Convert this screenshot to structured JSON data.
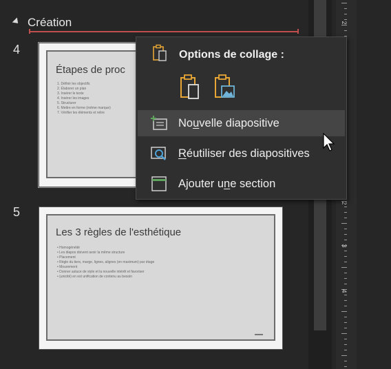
{
  "section": {
    "name": "Création"
  },
  "slides": [
    {
      "number": "4",
      "title": "Étapes de proc",
      "bullets": [
        "1.  Définir les objectifs",
        "2.  Élaborer un plan",
        "3.  Insérer le texte",
        "4.  Insérer les images",
        "5.  Structurer",
        "6.  Mettre en forme (même marque)",
        "7.  Vérifier les éléments et relire"
      ]
    },
    {
      "number": "5",
      "title": "Les 3 règles de l'esthétique",
      "bullets": [
        "•  Homogénéité",
        "•  Les diapos doivent avoir la même structure",
        "•  Placement",
        "•  Règle du tiers, marge, lignes, alignes (en maximum) par étage",
        "•  Mouvement",
        "•  Donner astuce de style et la nouvelle intérêt et favoriser",
        "•  (unicité) en est unification de contenu au besoin"
      ]
    }
  ],
  "context_menu": {
    "heading": "Options de collage :",
    "paste_options": [
      {
        "name": "keep-source-formatting"
      },
      {
        "name": "picture"
      }
    ],
    "items": [
      {
        "pre": "No",
        "underline": "u",
        "post": "velle diapositive",
        "highlighted": true
      },
      {
        "pre": "",
        "underline": "R",
        "post": "éutiliser des diapositives",
        "highlighted": false
      },
      {
        "pre": "Ajouter u",
        "underline": "n",
        "post": "e section",
        "highlighted": false
      }
    ]
  },
  "ruler": {
    "labels": [
      "2",
      "1",
      "1",
      "2",
      "3",
      "4"
    ]
  },
  "colors": {
    "accent_orange": "#e8a735",
    "section_line": "#c0504d",
    "menu_bg": "#2f2f2f",
    "highlight": "#454545",
    "teal_icon": "#4fa3a5",
    "green_icon": "#5fa35f"
  }
}
